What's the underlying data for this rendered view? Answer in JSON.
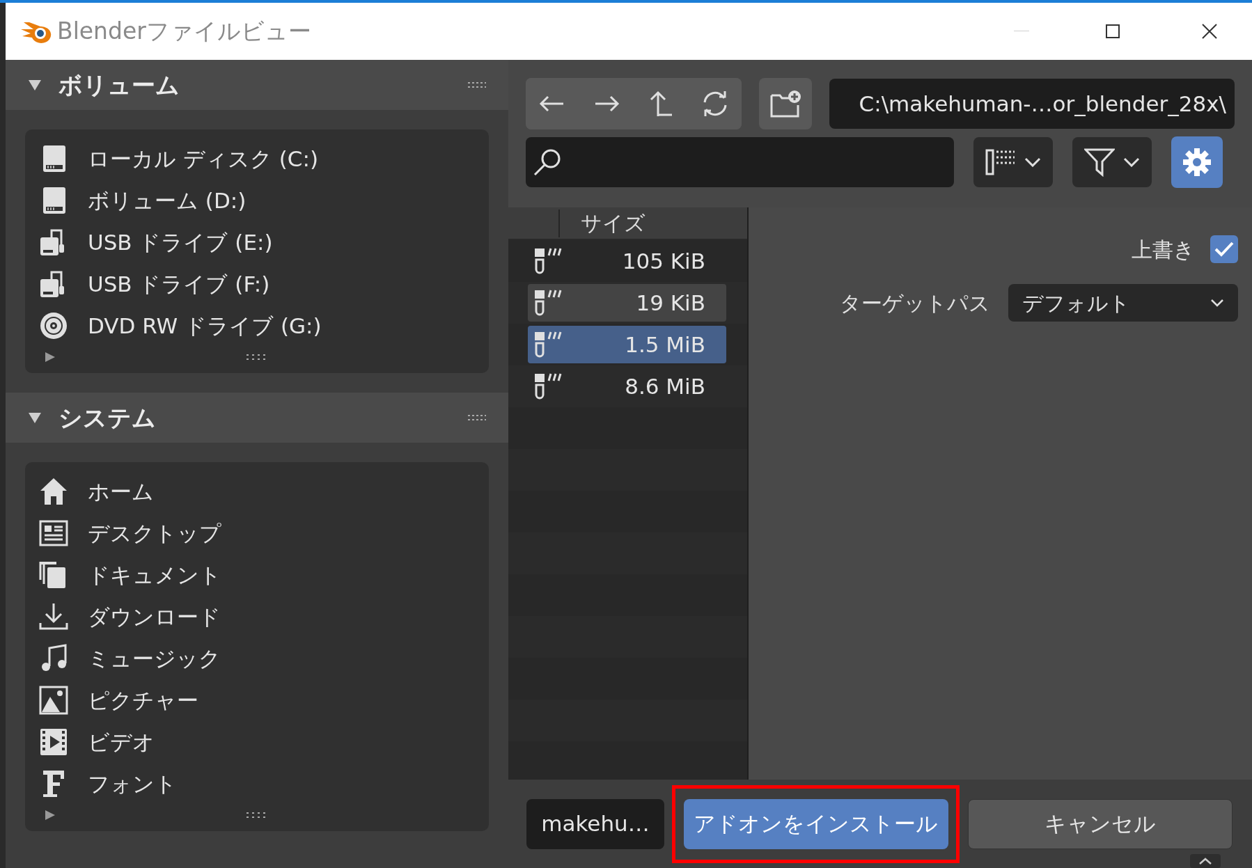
{
  "window": {
    "title": "Blenderファイルビュー"
  },
  "sidebar": {
    "sections": [
      {
        "title": "ボリューム",
        "expanded": true,
        "items": [
          {
            "label": "ローカル ディスク (C:)",
            "kind": "disk"
          },
          {
            "label": "ボリューム (D:)",
            "kind": "disk"
          },
          {
            "label": "USB ドライブ (E:)",
            "kind": "usb"
          },
          {
            "label": "USB ドライブ (F:)",
            "kind": "usb"
          },
          {
            "label": "DVD RW ドライブ (G:)",
            "kind": "dvd"
          }
        ]
      },
      {
        "title": "システム",
        "expanded": true,
        "items": [
          {
            "label": "ホーム",
            "kind": "home"
          },
          {
            "label": "デスクトップ",
            "kind": "desktop"
          },
          {
            "label": "ドキュメント",
            "kind": "documents"
          },
          {
            "label": "ダウンロード",
            "kind": "download"
          },
          {
            "label": "ミュージック",
            "kind": "music"
          },
          {
            "label": "ピクチャー",
            "kind": "pictures"
          },
          {
            "label": "ビデオ",
            "kind": "video"
          },
          {
            "label": "フォント",
            "kind": "font"
          }
        ]
      }
    ]
  },
  "toolbar": {
    "path": "C:\\makehuman-…or_blender_28x\\"
  },
  "file_list": {
    "column": "サイズ",
    "rows": [
      {
        "size": "105 KiB",
        "selected": false,
        "hovered": false
      },
      {
        "size": "19 KiB",
        "selected": false,
        "hovered": true
      },
      {
        "size": "1.5 MiB",
        "selected": true,
        "hovered": false
      },
      {
        "size": "8.6 MiB",
        "selected": false,
        "hovered": false
      }
    ]
  },
  "options": {
    "overwrite": {
      "label": "上書き",
      "checked": true
    },
    "target_path": {
      "label": "ターゲットパス",
      "value": "デフォルト"
    }
  },
  "footer": {
    "filename": "makehu…",
    "install_button": "アドオンをインストール",
    "cancel_button": "キャンセル"
  }
}
